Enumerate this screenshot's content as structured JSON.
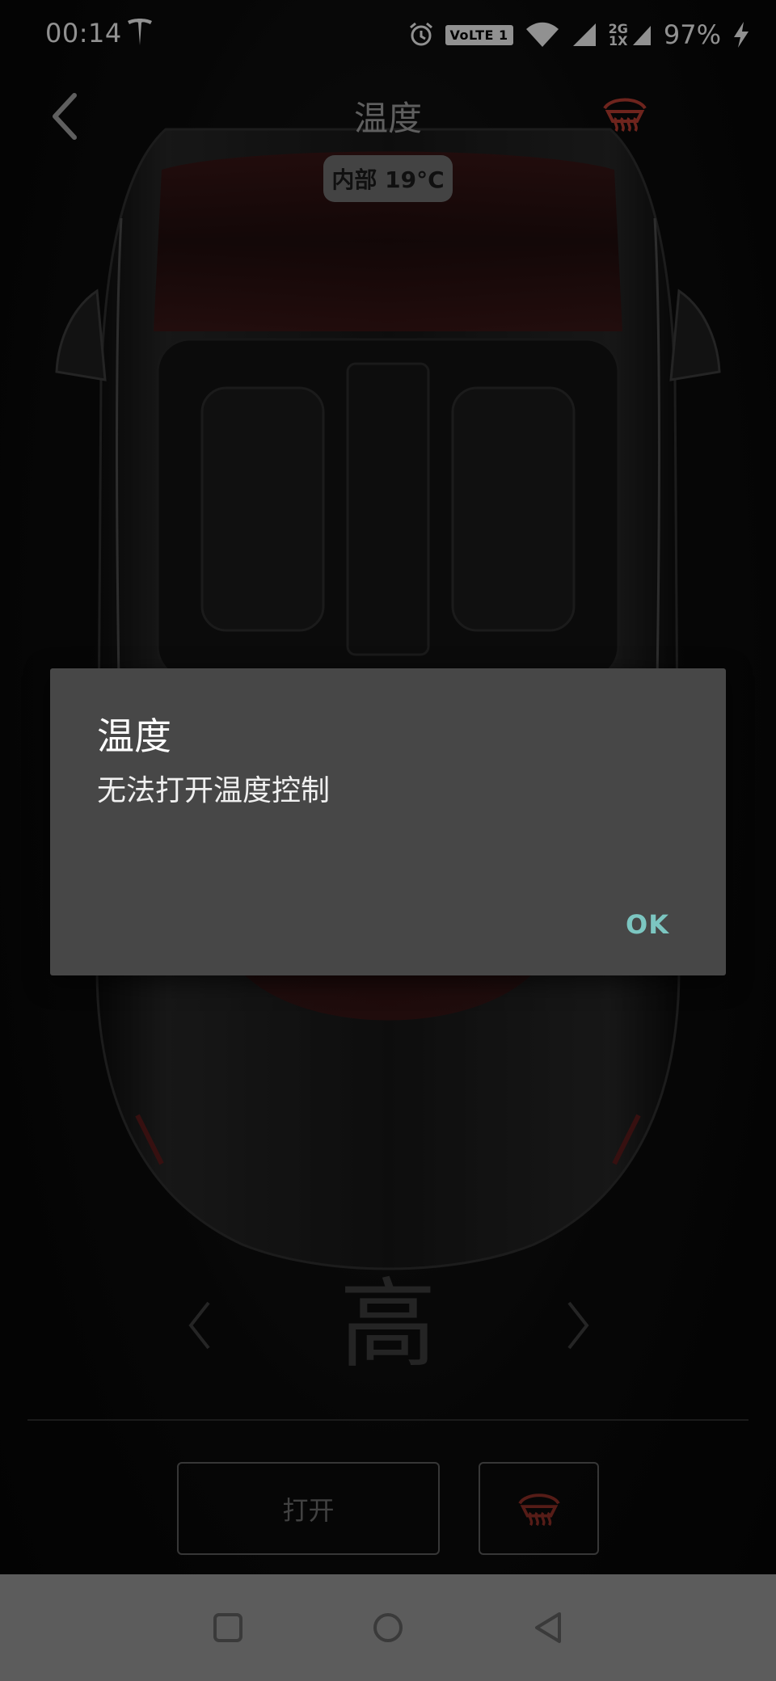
{
  "status_bar": {
    "time": "00:14",
    "volte": "VoLTE 1",
    "network_top": "2G",
    "network_bottom": "1X",
    "battery": "97%",
    "icons": [
      "tesla-logo-icon",
      "alarm-icon",
      "wifi-icon",
      "signal-icon",
      "signal-icon",
      "charging-icon"
    ]
  },
  "header": {
    "title": "温度",
    "interior_temp": "内部 19°C",
    "back_icon": "chevron-left-icon",
    "defrost_icon": "rear-defrost-icon"
  },
  "fan": {
    "level": "高",
    "prev_icon": "chevron-left-icon",
    "next_icon": "chevron-right-icon"
  },
  "controls": {
    "power_label": "打开",
    "defrost_icon": "rear-defrost-icon"
  },
  "dialog": {
    "title": "温度",
    "message": "无法打开温度控制",
    "ok_label": "OK"
  },
  "nav": {
    "icons": [
      "recent-apps-icon",
      "home-icon",
      "back-icon"
    ]
  },
  "colors": {
    "accent_red": "#c0392b",
    "dialog_bg": "#474747",
    "ok_teal": "#7cc6c1",
    "nav_bg": "#5c5c5c"
  }
}
